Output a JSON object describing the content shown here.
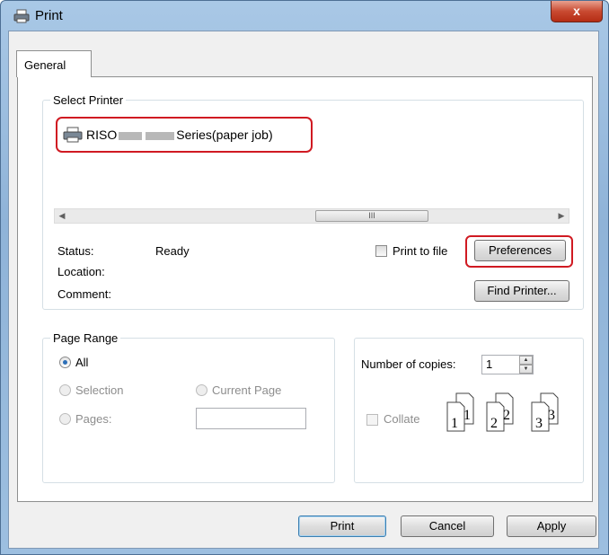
{
  "window": {
    "title": "Print",
    "close_glyph": "x"
  },
  "tabs": [
    {
      "label": "General",
      "selected": true
    }
  ],
  "select_printer": {
    "legend": "Select Printer",
    "printer": {
      "name_prefix": "RISO",
      "name_suffix": "Series(paper job)",
      "icon": "printer-icon"
    },
    "scrollbar_grip": "III"
  },
  "status": {
    "status_label": "Status:",
    "status_value": "Ready",
    "location_label": "Location:",
    "comment_label": "Comment:"
  },
  "print_to_file": {
    "label": "Print to file",
    "checked": false
  },
  "buttons": {
    "preferences": "Preferences",
    "find_printer": "Find Printer...",
    "print": "Print",
    "cancel": "Cancel",
    "apply": "Apply"
  },
  "page_range": {
    "legend": "Page Range",
    "all": "All",
    "selection": "Selection",
    "current_page": "Current Page",
    "pages": "Pages:",
    "selected": "All"
  },
  "copies": {
    "label": "Number of copies:",
    "value": "1",
    "collate_label": "Collate",
    "collate_checked": false
  },
  "collate_pages": [
    "1",
    "1",
    "2",
    "2",
    "3",
    "3"
  ],
  "colors": {
    "highlight": "#d01a22",
    "title_gradient": "#a9c8e6",
    "close_button": "#c94a31"
  }
}
